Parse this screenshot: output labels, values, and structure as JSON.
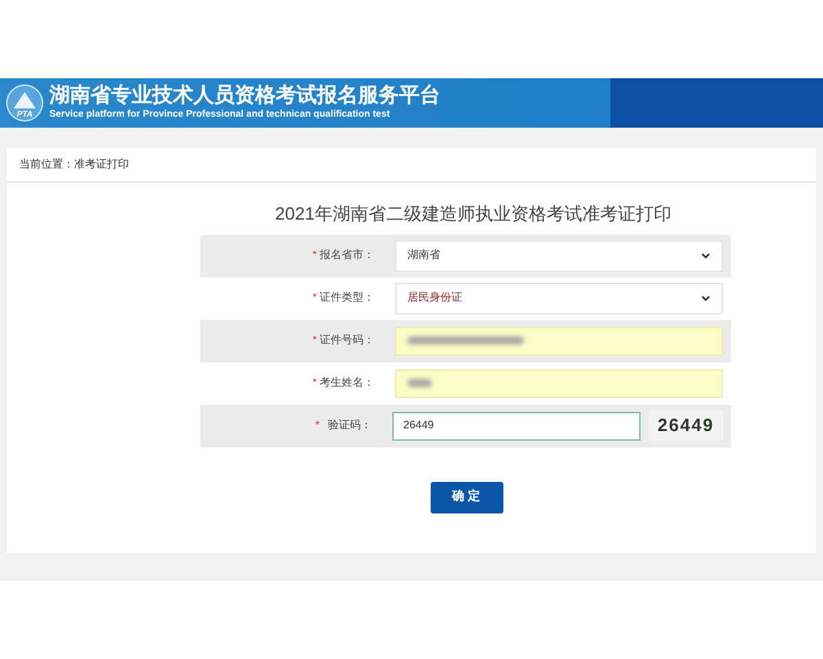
{
  "header": {
    "logo_text": "PTA",
    "title": "湖南省专业技术人员资格考试报名服务平台",
    "subtitle": "Service platform for Province Professional and technican qualification test"
  },
  "breadcrumb": "当前位置：准考证打印",
  "form": {
    "title": "2021年湖南省二级建造师执业资格考试准考证打印",
    "fields": [
      {
        "kind": "select",
        "required_mark": "*",
        "label": "报名省市：",
        "value": "湖南省"
      },
      {
        "kind": "select",
        "required_mark": "*",
        "label": "证件类型：",
        "value": "居民身份证"
      },
      {
        "kind": "blurred",
        "required_mark": "*",
        "label": "证件号码："
      },
      {
        "kind": "blurred",
        "required_mark": "*",
        "label": "考生姓名："
      },
      {
        "kind": "captcha",
        "required_mark": "*",
        "label": "验证码：",
        "value": "26449",
        "captcha": "26449"
      }
    ],
    "submit": "确 定"
  }
}
